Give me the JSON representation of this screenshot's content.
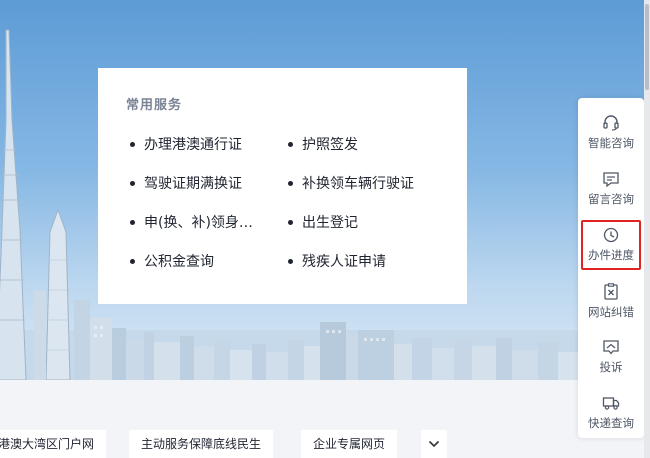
{
  "card": {
    "title": "常用服务",
    "services": [
      "办理港澳通行证",
      "护照签发",
      "驾驶证期满换证",
      "补换领车辆行驶证",
      "申(换、补)领身…",
      "出生登记",
      "公积金查询",
      "残疾人证申请"
    ]
  },
  "chips": [
    "港澳大湾区门户网",
    "主动服务保障底线民生",
    "企业专属网页"
  ],
  "rightbar": {
    "items": [
      {
        "label": "智能咨询",
        "icon": "headset-icon"
      },
      {
        "label": "留言咨询",
        "icon": "message-icon"
      },
      {
        "label": "办件进度",
        "icon": "clock-icon"
      },
      {
        "label": "网站纠错",
        "icon": "error-report-icon"
      },
      {
        "label": "投诉",
        "icon": "complaint-icon"
      },
      {
        "label": "快递查询",
        "icon": "truck-icon"
      }
    ],
    "active_index": 2
  },
  "colors": {
    "accent_red": "#e02424",
    "text": "#1f2430",
    "sky_top": "#5d9bd6"
  }
}
